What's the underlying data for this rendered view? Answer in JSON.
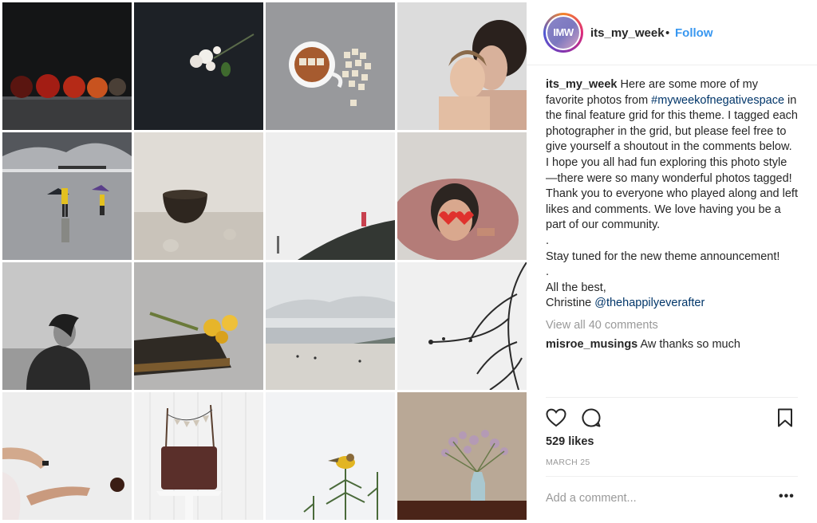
{
  "post": {
    "avatar_text": "IMW",
    "username": "its_my_week",
    "separator": "•",
    "follow_label": "Follow"
  },
  "caption": {
    "username": "its_my_week",
    "text_1": " Here are some more of my favorite photos from ",
    "hashtag": "#myweekofnegativespace",
    "text_2": " in the final feature grid for this theme. I tagged each photographer in the grid, but please feel free to give yourself a shoutout in the comments below. I hope you all had fun exploring this photo style—there were so many wonderful photos tagged! Thank you to everyone who played along and left likes and comments. We love having you be a part of our community.",
    "dot_1": ".",
    "line_stay": "Stay tuned for the new theme announcement!",
    "dot_2": ".",
    "line_best": "All the best,",
    "signoff_name": "Christine ",
    "mention": "@thehappilyeverafter"
  },
  "comments": {
    "view_all": "View all 40 comments",
    "preview_user": "misroe_musings",
    "preview_text": " Aw thanks so much"
  },
  "actions": {
    "like_icon": "heart-icon",
    "comment_icon": "comment-bubble-icon",
    "save_icon": "bookmark-icon"
  },
  "likes": "529 likes",
  "date": "MARCH 25",
  "comment_box": {
    "placeholder": "Add a comment...",
    "more_label": "•••"
  },
  "grid": {
    "tiles": [
      "apples-on-dark-table",
      "white-blossom-on-dark",
      "teacup-and-letter-tiles",
      "mother-and-son",
      "children-with-umbrellas-on-beach",
      "dark-bowl-with-eggs",
      "figure-on-misty-hill",
      "girl-with-heart-sunglasses-in-tub",
      "girl-in-wind-black-and-white",
      "daffodils-on-book",
      "misty-beach",
      "bare-branches",
      "hand-and-falling-ball",
      "chocolate-cake-with-bunting",
      "bird-on-pine",
      "vase-with-flowers"
    ]
  }
}
